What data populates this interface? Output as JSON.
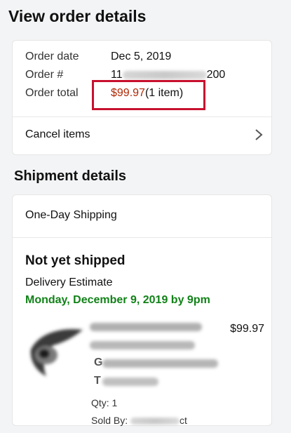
{
  "header": {
    "title": "View order details"
  },
  "order": {
    "date_label": "Order date",
    "date_value": "Dec 5, 2019",
    "number_label": "Order #",
    "number_prefix": "11",
    "number_suffix": "200",
    "total_label": "Order total",
    "total_amount": "$99.97",
    "total_items": "(1 item)",
    "highlight_color": "#c8102e",
    "cancel_label": "Cancel items"
  },
  "shipment": {
    "section_title": "Shipment details",
    "method": "One-Day Shipping",
    "status": "Not yet shipped",
    "estimate_label": "Delivery Estimate",
    "estimate_date": "Monday, December 9, 2019 by 9pm",
    "estimate_color": "#118218",
    "item": {
      "price": "$99.97",
      "title_initial_line3": "G",
      "title_initial_line4": "T",
      "qty": "Qty: 1",
      "sold_by_label": "Sold By:",
      "sold_by_suffix": "ct"
    }
  }
}
